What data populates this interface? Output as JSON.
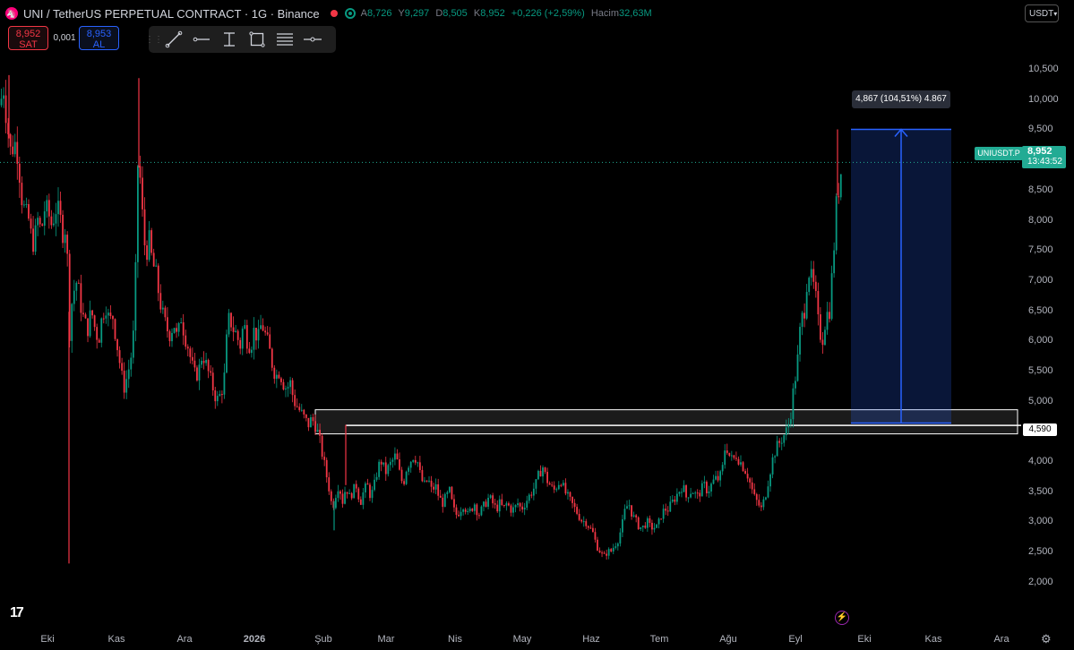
{
  "header": {
    "title": "UNI / TetherUS PERPETUAL CONTRACT · 1G · Binance",
    "ohlc": [
      {
        "k": "A",
        "v": "8,726"
      },
      {
        "k": "Y",
        "v": "9,297"
      },
      {
        "k": "D",
        "v": "8,505"
      },
      {
        "k": "K",
        "v": "8,952"
      }
    ],
    "change": "+0,226 (+2,59%)",
    "volume_label": "Hacim",
    "volume": "32,63M"
  },
  "trade": {
    "sell_price": "8,952",
    "sell_label": "SAT",
    "spread": "0,001",
    "buy_price": "8,953",
    "buy_label": "AL"
  },
  "toolbar": {
    "tools": [
      "drag-handle-icon",
      "trend-line-icon",
      "horizontal-ray-icon",
      "vertical-text-icon",
      "rectangle-icon",
      "parallel-channel-icon",
      "horizontal-line-icon"
    ]
  },
  "currency": "USDT",
  "last_price": {
    "symbol": "UNIUSDT.P",
    "price": "8,952",
    "countdown": "13:43:52"
  },
  "level_label": "4,590",
  "measure_label": "4,867 (104,51%) 4.867",
  "colors": {
    "up": "#089981",
    "down": "#f23645",
    "measure": "#2962ff",
    "badge": "#22ab94"
  },
  "chart_data": {
    "type": "candlestick",
    "x_tick_labels": [
      "Eki",
      "Kas",
      "Ara",
      "2026",
      "Şub",
      "Mar",
      "Nis",
      "May",
      "Haz",
      "Tem",
      "Ağu",
      "Eyl",
      "Eki",
      "Kas",
      "Ara"
    ],
    "y_tick_labels": [
      "2,000",
      "2,500",
      "3,000",
      "3,500",
      "4,000",
      "4,500",
      "5,000",
      "5,500",
      "6,000",
      "6,500",
      "7,000",
      "7,500",
      "8,000",
      "8,500",
      "9,000",
      "9,500",
      "10,000",
      "10,500"
    ],
    "ylim": [
      1.4,
      11.2
    ],
    "last_close": 8.952,
    "support_zone": [
      4.45,
      4.85
    ],
    "support_level": 4.59,
    "measure": {
      "from": 4.63,
      "to": 9.5,
      "change": "4,867",
      "percent": "104,51%"
    },
    "close_path": [
      [
        0,
        9.9
      ],
      [
        4,
        10.2
      ],
      [
        8,
        9.6
      ],
      [
        12,
        9.1
      ],
      [
        16,
        9.3
      ],
      [
        20,
        9.1
      ],
      [
        24,
        8.4
      ],
      [
        28,
        8.1
      ],
      [
        32,
        8.0
      ],
      [
        35,
        7.7
      ],
      [
        38,
        7.6
      ],
      [
        42,
        8.0
      ],
      [
        46,
        7.8
      ],
      [
        50,
        8.2
      ],
      [
        54,
        8.1
      ],
      [
        58,
        7.9
      ],
      [
        62,
        8.2
      ],
      [
        66,
        8.1
      ],
      [
        70,
        7.8
      ],
      [
        74,
        7.9
      ],
      [
        78,
        6.0
      ],
      [
        80,
        6.6
      ],
      [
        82,
        6.8
      ],
      [
        86,
        7.0
      ],
      [
        90,
        6.6
      ],
      [
        94,
        6.3
      ],
      [
        98,
        6.2
      ],
      [
        102,
        6.5
      ],
      [
        106,
        6.2
      ],
      [
        110,
        6.0
      ],
      [
        114,
        6.4
      ],
      [
        118,
        6.6
      ],
      [
        122,
        6.3
      ],
      [
        126,
        6.4
      ],
      [
        130,
        6.0
      ],
      [
        134,
        5.6
      ],
      [
        138,
        5.2
      ],
      [
        142,
        5.4
      ],
      [
        146,
        5.7
      ],
      [
        149,
        6.1
      ],
      [
        152,
        7.4
      ],
      [
        154,
        9.0
      ],
      [
        157,
        8.6
      ],
      [
        160,
        7.8
      ],
      [
        163,
        7.4
      ],
      [
        166,
        7.7
      ],
      [
        170,
        7.3
      ],
      [
        174,
        7.1
      ],
      [
        178,
        6.7
      ],
      [
        182,
        6.4
      ],
      [
        186,
        6.2
      ],
      [
        190,
        6.1
      ],
      [
        194,
        6.3
      ],
      [
        198,
        6.0
      ],
      [
        202,
        6.4
      ],
      [
        206,
        6.1
      ],
      [
        210,
        5.9
      ],
      [
        214,
        5.6
      ],
      [
        218,
        5.4
      ],
      [
        222,
        5.5
      ],
      [
        226,
        5.8
      ],
      [
        230,
        5.6
      ],
      [
        234,
        5.4
      ],
      [
        238,
        5.2
      ],
      [
        242,
        5.0
      ],
      [
        246,
        5.1
      ],
      [
        250,
        5.3
      ],
      [
        253,
        6.0
      ],
      [
        256,
        6.4
      ],
      [
        260,
        6.2
      ],
      [
        264,
        6.1
      ],
      [
        268,
        5.9
      ],
      [
        272,
        6.3
      ],
      [
        276,
        6.0
      ],
      [
        280,
        5.9
      ],
      [
        284,
        6.2
      ],
      [
        288,
        6.0
      ],
      [
        292,
        6.3
      ],
      [
        296,
        6.1
      ],
      [
        300,
        5.9
      ],
      [
        304,
        5.6
      ],
      [
        308,
        5.4
      ],
      [
        312,
        5.5
      ],
      [
        316,
        5.3
      ],
      [
        320,
        5.2
      ],
      [
        324,
        5.3
      ],
      [
        328,
        5.0
      ],
      [
        332,
        4.9
      ],
      [
        336,
        4.8
      ],
      [
        340,
        4.7
      ],
      [
        344,
        4.6
      ],
      [
        348,
        4.7
      ],
      [
        352,
        4.6
      ],
      [
        356,
        4.4
      ],
      [
        360,
        4.1
      ],
      [
        364,
        3.8
      ],
      [
        368,
        3.5
      ],
      [
        371,
        3.2
      ],
      [
        374,
        3.4
      ],
      [
        377,
        3.6
      ],
      [
        380,
        3.5
      ],
      [
        383,
        3.3
      ],
      [
        386,
        3.6
      ],
      [
        390,
        3.4
      ],
      [
        394,
        3.5
      ],
      [
        398,
        3.6
      ],
      [
        402,
        3.3
      ],
      [
        406,
        3.5
      ],
      [
        410,
        3.6
      ],
      [
        414,
        3.4
      ],
      [
        418,
        3.6
      ],
      [
        422,
        3.9
      ],
      [
        426,
        4.0
      ],
      [
        430,
        3.8
      ],
      [
        434,
        3.9
      ],
      [
        438,
        4.0
      ],
      [
        442,
        4.1
      ],
      [
        446,
        3.8
      ],
      [
        450,
        3.6
      ],
      [
        454,
        3.9
      ],
      [
        458,
        4.0
      ],
      [
        462,
        4.1
      ],
      [
        466,
        4.0
      ],
      [
        470,
        3.7
      ],
      [
        474,
        3.6
      ],
      [
        478,
        3.7
      ],
      [
        482,
        3.5
      ],
      [
        486,
        3.6
      ],
      [
        490,
        3.4
      ],
      [
        494,
        3.3
      ],
      [
        498,
        3.4
      ],
      [
        502,
        3.5
      ],
      [
        506,
        3.2
      ],
      [
        510,
        3.1
      ],
      [
        514,
        3.2
      ],
      [
        518,
        3.3
      ],
      [
        522,
        3.1
      ],
      [
        526,
        3.2
      ],
      [
        530,
        3.3
      ],
      [
        534,
        3.1
      ],
      [
        538,
        3.2
      ],
      [
        542,
        3.3
      ],
      [
        546,
        3.4
      ],
      [
        550,
        3.3
      ],
      [
        554,
        3.2
      ],
      [
        558,
        3.3
      ],
      [
        562,
        3.2
      ],
      [
        566,
        3.3
      ],
      [
        570,
        3.2
      ],
      [
        574,
        3.2
      ],
      [
        578,
        3.3
      ],
      [
        582,
        3.2
      ],
      [
        586,
        3.3
      ],
      [
        590,
        3.4
      ],
      [
        594,
        3.5
      ],
      [
        598,
        3.6
      ],
      [
        602,
        3.8
      ],
      [
        606,
        3.9
      ],
      [
        610,
        3.7
      ],
      [
        614,
        3.6
      ],
      [
        618,
        3.5
      ],
      [
        622,
        3.6
      ],
      [
        626,
        3.7
      ],
      [
        630,
        3.5
      ],
      [
        634,
        3.4
      ],
      [
        638,
        3.3
      ],
      [
        642,
        3.2
      ],
      [
        646,
        3.1
      ],
      [
        650,
        3.0
      ],
      [
        654,
        3.0
      ],
      [
        658,
        2.9
      ],
      [
        662,
        2.8
      ],
      [
        666,
        2.6
      ],
      [
        670,
        2.5
      ],
      [
        674,
        2.4
      ],
      [
        678,
        2.5
      ],
      [
        682,
        2.5
      ],
      [
        686,
        2.6
      ],
      [
        690,
        2.7
      ],
      [
        694,
        2.9
      ],
      [
        698,
        3.2
      ],
      [
        702,
        3.3
      ],
      [
        706,
        3.1
      ],
      [
        710,
        3.0
      ],
      [
        714,
        2.9
      ],
      [
        718,
        2.9
      ],
      [
        722,
        3.0
      ],
      [
        726,
        2.9
      ],
      [
        730,
        2.9
      ],
      [
        734,
        2.9
      ],
      [
        738,
        3.1
      ],
      [
        742,
        3.2
      ],
      [
        746,
        3.2
      ],
      [
        750,
        3.3
      ],
      [
        754,
        3.4
      ],
      [
        758,
        3.5
      ],
      [
        762,
        3.6
      ],
      [
        766,
        3.4
      ],
      [
        770,
        3.5
      ],
      [
        774,
        3.5
      ],
      [
        778,
        3.4
      ],
      [
        782,
        3.5
      ],
      [
        786,
        3.6
      ],
      [
        790,
        3.5
      ],
      [
        794,
        3.6
      ],
      [
        798,
        3.7
      ],
      [
        802,
        3.7
      ],
      [
        806,
        3.8
      ],
      [
        810,
        4.3
      ],
      [
        814,
        4.1
      ],
      [
        818,
        4.0
      ],
      [
        822,
        4.1
      ],
      [
        826,
        4.0
      ],
      [
        830,
        3.9
      ],
      [
        834,
        3.8
      ],
      [
        838,
        3.6
      ],
      [
        842,
        3.4
      ],
      [
        846,
        3.3
      ],
      [
        850,
        3.2
      ],
      [
        854,
        3.4
      ],
      [
        858,
        3.7
      ],
      [
        862,
        4.0
      ],
      [
        866,
        4.2
      ],
      [
        870,
        4.3
      ],
      [
        874,
        4.4
      ],
      [
        878,
        4.5
      ],
      [
        882,
        4.7
      ],
      [
        886,
        5.2
      ],
      [
        890,
        5.6
      ],
      [
        894,
        6.3
      ],
      [
        898,
        6.5
      ],
      [
        902,
        7.2
      ],
      [
        906,
        7.0
      ],
      [
        910,
        6.8
      ],
      [
        914,
        6.2
      ],
      [
        918,
        6.0
      ],
      [
        922,
        6.4
      ],
      [
        926,
        6.5
      ],
      [
        930,
        7.3
      ],
      [
        934,
        8.3
      ],
      [
        937,
        8.6
      ],
      [
        940,
        8.952
      ]
    ],
    "spikes": [
      {
        "x": 10,
        "hi": 10.4
      },
      {
        "x": 77,
        "lo": 2.3
      },
      {
        "x": 155,
        "hi": 10.35
      },
      {
        "x": 373,
        "lo": 2.85
      },
      {
        "x": 386,
        "hi": 4.6
      },
      {
        "x": 935,
        "hi": 9.5
      }
    ]
  }
}
